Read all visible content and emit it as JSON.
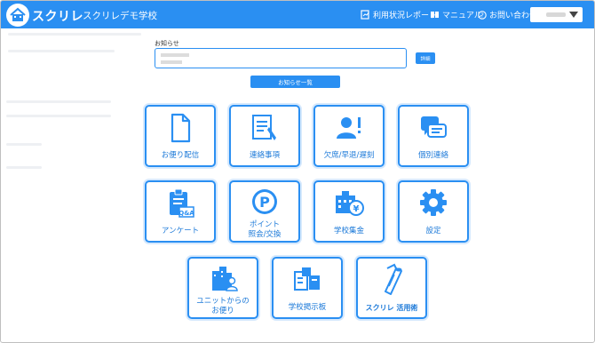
{
  "header": {
    "app_title": "スクリレ",
    "school_name": "スクリレデモ学校",
    "nav": {
      "usage_report": "利用状況レポート",
      "manual": "マニュアル",
      "contact": "お問い合わせ"
    }
  },
  "notice": {
    "label": "お知らせ",
    "detail_button": "詳細",
    "list_button": "お知らせ一覧"
  },
  "tiles": [
    {
      "line1": "お便り配信",
      "line2": ""
    },
    {
      "line1": "連絡事項",
      "line2": ""
    },
    {
      "line1": "欠席/早退/遅刻",
      "line2": ""
    },
    {
      "line1": "個別連絡",
      "line2": ""
    },
    {
      "line1": "アンケート",
      "line2": ""
    },
    {
      "line1": "ポイント",
      "line2": "照会/交換"
    },
    {
      "line1": "学校集金",
      "line2": ""
    },
    {
      "line1": "設定",
      "line2": ""
    },
    {
      "line1": "ユニットからの",
      "line2": "お便り"
    },
    {
      "line1": "学校掲示板",
      "line2": ""
    },
    {
      "line1": "スクリレ 活用術",
      "line2": ""
    }
  ],
  "icon_text": {
    "qa": "Q&A",
    "point": "P",
    "yen": "¥"
  },
  "colors": {
    "accent": "#2a8ff2",
    "text": "#1a78d8"
  }
}
